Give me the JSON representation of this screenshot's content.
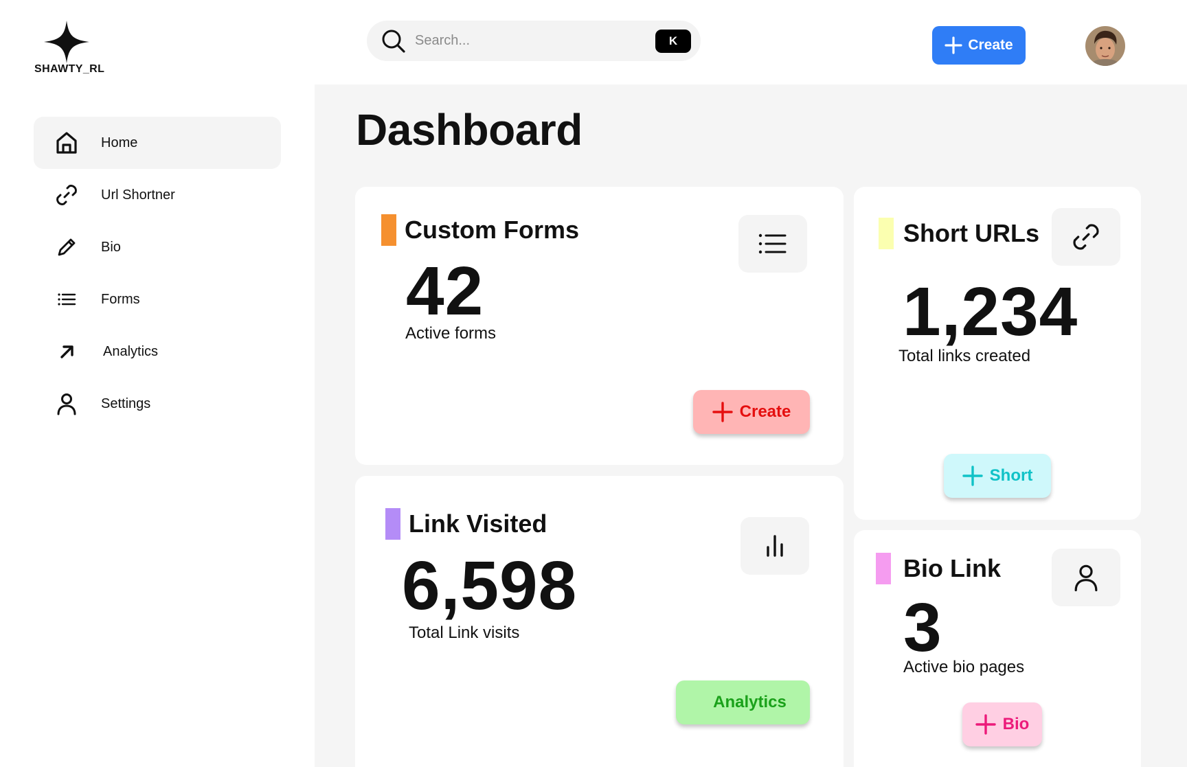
{
  "brand": {
    "name": "SHAWTY_RL"
  },
  "search": {
    "placeholder": "Search...",
    "shortcut": "K"
  },
  "header": {
    "create_label": "Create"
  },
  "sidebar": {
    "items": [
      {
        "label": "Home",
        "icon": "home-icon",
        "active": true
      },
      {
        "label": "Url Shortner",
        "icon": "link-icon"
      },
      {
        "label": "Bio",
        "icon": "pencil-icon"
      },
      {
        "label": "Forms",
        "icon": "list-icon"
      },
      {
        "label": "Analytics",
        "icon": "arrow-up-right-icon"
      },
      {
        "label": "Settings",
        "icon": "user-icon"
      }
    ]
  },
  "page": {
    "title": "Dashboard"
  },
  "cards": {
    "forms": {
      "title": "Custom Forms",
      "value": "42",
      "caption": "Active forms",
      "button": "Create",
      "accent": "#f5902f",
      "icon": "list-icon"
    },
    "urls": {
      "title": "Short URLs",
      "value": "1,234",
      "caption": "Total links created",
      "button": "Short",
      "accent": "#fbffb0",
      "icon": "link-icon"
    },
    "visits": {
      "title": "Link Visited",
      "value": "6,598",
      "caption": "Total Link visits",
      "button": "Analytics",
      "accent": "#b48cf7",
      "icon": "bar-chart-icon"
    },
    "bio": {
      "title": "Bio Link",
      "value": "3",
      "caption": "Active bio pages",
      "button": "Bio",
      "accent": "#f59cf0",
      "icon": "user-icon"
    }
  },
  "colors": {
    "primary": "#2f7df6",
    "create_btn_bg": "#ffb5b5",
    "create_btn_fg": "#e50f0f",
    "short_btn_bg": "#cff8fb",
    "short_btn_fg": "#10c2c7",
    "analytics_btn_bg": "#b0f5a8",
    "analytics_btn_fg": "#1aa11a",
    "bio_btn_bg": "#ffcfe3",
    "bio_btn_fg": "#ec1a7a"
  }
}
